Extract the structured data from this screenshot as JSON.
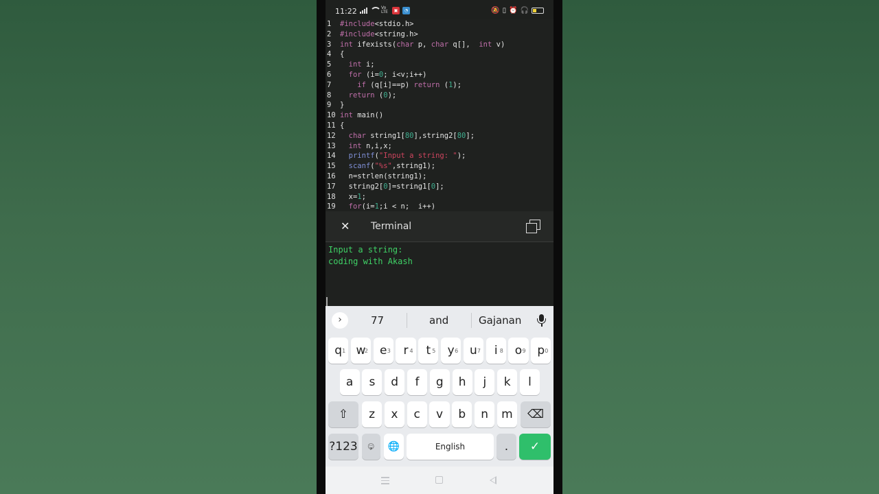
{
  "status_bar": {
    "time": "11:22",
    "volte": "Vo LTE",
    "badge1": "AB",
    "icons": [
      "signal-icon",
      "wifi-icon",
      "mute-icon",
      "vibrate-icon",
      "alarm-icon",
      "headphones-icon",
      "battery-icon"
    ]
  },
  "code": {
    "lines": [
      {
        "n": "1",
        "html": "<span class=\"pp\">#include</span>&lt;stdio.h&gt;"
      },
      {
        "n": "2",
        "html": "<span class=\"pp\">#include</span>&lt;string.h&gt;"
      },
      {
        "n": "3",
        "html": "<span class=\"kw\">int</span> ifexists(<span class=\"kw\">char</span> p, <span class=\"kw\">char</span> q[],  <span class=\"kw\">int</span> v)"
      },
      {
        "n": "4",
        "html": "{"
      },
      {
        "n": "5",
        "html": "  <span class=\"kw\">int</span> i;"
      },
      {
        "n": "6",
        "html": "  <span class=\"kw\">for</span> (i=<span class=\"num\">0</span>; i&lt;v;i++)"
      },
      {
        "n": "7",
        "html": "    <span class=\"kw\">if</span> (q[i]==p) <span class=\"kw\">return</span> (<span class=\"num\">1</span>);"
      },
      {
        "n": "8",
        "html": "  <span class=\"kw\">return</span> (<span class=\"num\">0</span>);"
      },
      {
        "n": "9",
        "html": "}"
      },
      {
        "n": "10",
        "html": "<span class=\"kw\">int</span> main()"
      },
      {
        "n": "11",
        "html": "{"
      },
      {
        "n": "12",
        "html": "  <span class=\"kw\">char</span> string1[<span class=\"num\">80</span>],string2[<span class=\"num\">80</span>];"
      },
      {
        "n": "13",
        "html": "  <span class=\"kw\">int</span> n,i,x;"
      },
      {
        "n": "14",
        "html": "  <span class=\"fn\">printf</span>(<span class=\"str\">\"Input a string: \"</span>);"
      },
      {
        "n": "15",
        "html": "  <span class=\"fn\">scanf</span>(<span class=\"str\">\"%s\"</span>,string1);"
      },
      {
        "n": "16",
        "html": "  n=strlen(string1);"
      },
      {
        "n": "17",
        "html": "  string2[<span class=\"num\">0</span>]=string1[<span class=\"num\">0</span>];"
      },
      {
        "n": "18",
        "html": "  x=<span class=\"num\">1</span>;"
      },
      {
        "n": "19",
        "html": "  <span class=\"kw\">for</span>(i=<span class=\"num\">1</span>;i &lt; n;  i++)"
      }
    ]
  },
  "terminal": {
    "title": "Terminal",
    "output": [
      "Input a string:",
      "coding with Akash"
    ]
  },
  "keyboard": {
    "suggestions": [
      "77",
      "and",
      "Gajanan"
    ],
    "row1": [
      {
        "k": "q",
        "h": "1"
      },
      {
        "k": "w",
        "h": "2"
      },
      {
        "k": "e",
        "h": "3"
      },
      {
        "k": "r",
        "h": "4"
      },
      {
        "k": "t",
        "h": "5"
      },
      {
        "k": "y",
        "h": "6"
      },
      {
        "k": "u",
        "h": "7"
      },
      {
        "k": "i",
        "h": "8"
      },
      {
        "k": "o",
        "h": "9"
      },
      {
        "k": "p",
        "h": "0"
      }
    ],
    "row2": [
      "a",
      "s",
      "d",
      "f",
      "g",
      "h",
      "j",
      "k",
      "l"
    ],
    "row3": [
      "z",
      "x",
      "c",
      "v",
      "b",
      "n",
      "m"
    ],
    "symbols_label": "?123",
    "emoji_label": "☺",
    "comma_label": ",",
    "space_label": "English",
    "period_label": ".",
    "enter_label": "✓",
    "shift_label": "⇧",
    "backspace_label": "⌫",
    "globe_label": "🌐"
  },
  "colors": {
    "terminal_text": "#3fd266",
    "enter_key": "#2fbf6b",
    "background": "#3d6a4b"
  }
}
